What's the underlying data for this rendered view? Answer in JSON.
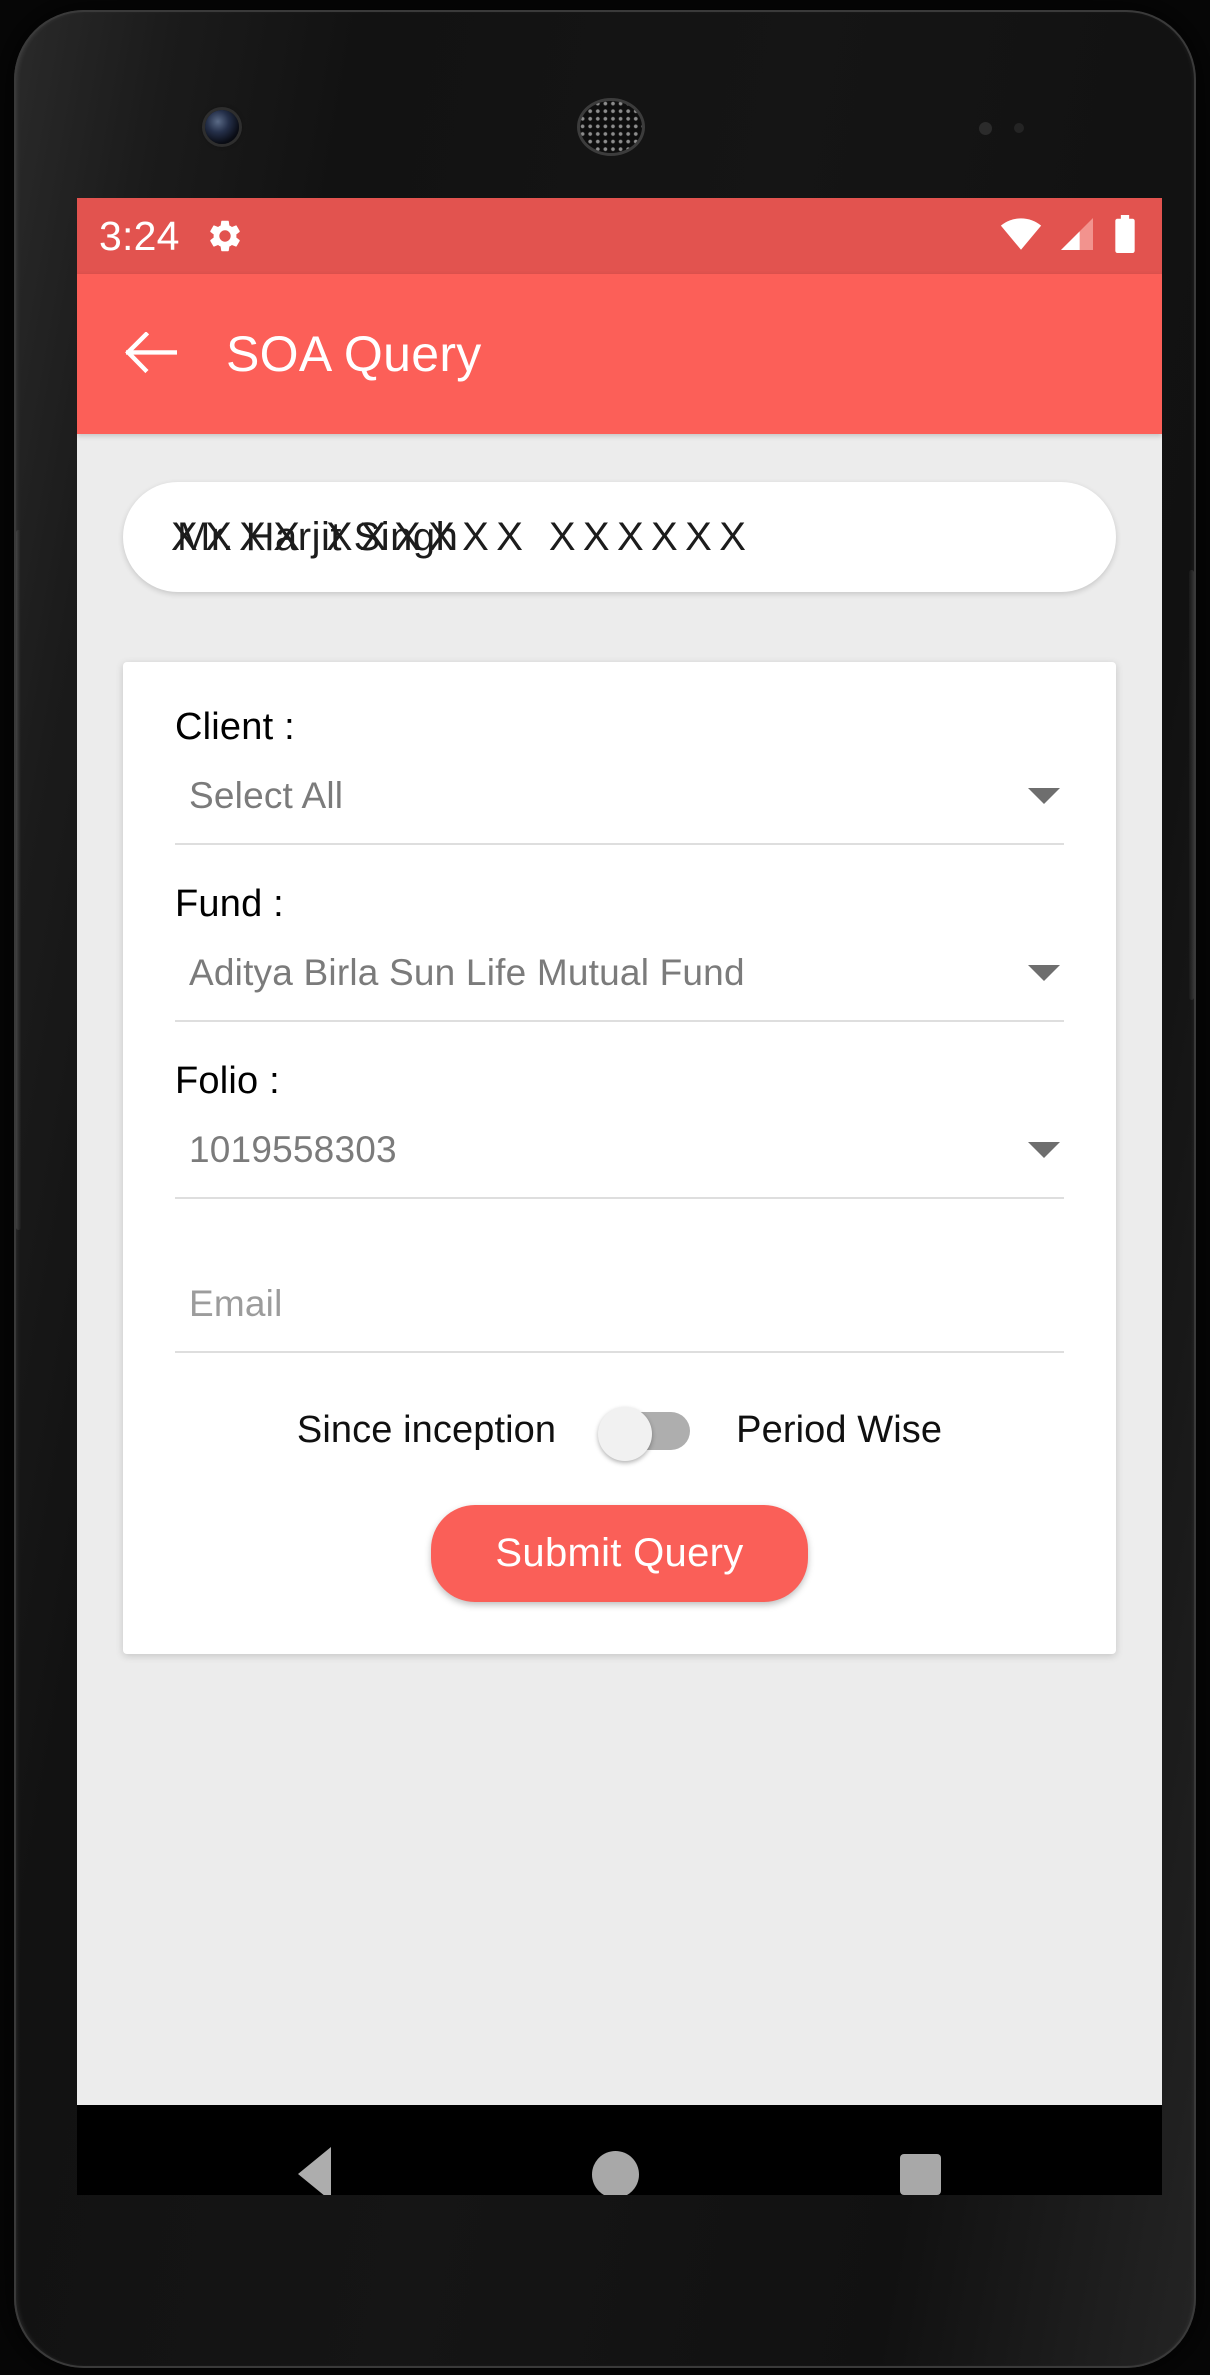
{
  "status_bar": {
    "time": "3:24",
    "gear_icon": "gear-icon",
    "wifi_icon": "wifi-icon",
    "signal_icon": "cellular-signal-icon",
    "battery_icon": "battery-full-icon"
  },
  "app_bar": {
    "back_icon": "back-arrow-icon",
    "title": "SOA Query"
  },
  "account": {
    "name_display": "Mr. Harjit Singh",
    "redaction_overlay": "XXXX XXXXXX XXXXXX"
  },
  "form": {
    "client": {
      "label": "Client :",
      "value": "Select All",
      "caret_icon": "chevron-down-icon"
    },
    "fund": {
      "label": "Fund :",
      "value": "Aditya Birla Sun Life Mutual Fund",
      "caret_icon": "chevron-down-icon"
    },
    "folio": {
      "label": "Folio :",
      "value": "1019558303",
      "caret_icon": "chevron-down-icon"
    },
    "email": {
      "placeholder": "Email",
      "value": ""
    },
    "period_toggle": {
      "left_label": "Since inception",
      "right_label": "Period Wise",
      "state": "off"
    },
    "submit_label": "Submit Query"
  },
  "nav_bar": {
    "back_icon": "nav-back-triangle-icon",
    "home_icon": "nav-home-circle-icon",
    "recents_icon": "nav-recents-square-icon"
  },
  "colors": {
    "status_bar": "#e2534f",
    "app_bar": "#fc5f58",
    "accent": "#fa5f58",
    "screen_bg": "#ececec",
    "card_bg": "#ffffff"
  }
}
